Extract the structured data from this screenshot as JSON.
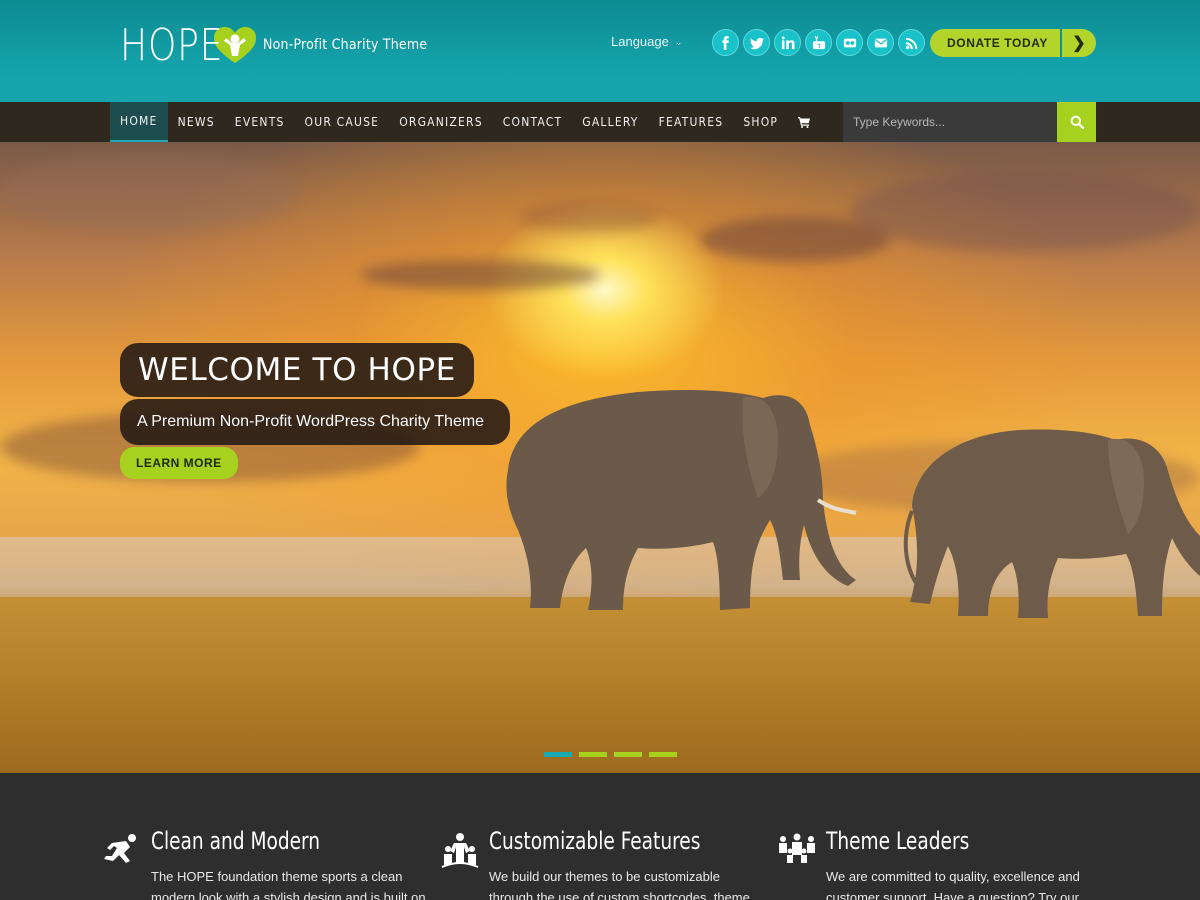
{
  "header": {
    "logo_text": "HOPE",
    "tagline": "Non-Profit Charity Theme",
    "language": "Language",
    "socials": [
      "facebook-icon",
      "twitter-icon",
      "linkedin-icon",
      "youtube-icon",
      "flickr-icon",
      "email-icon",
      "rss-icon"
    ],
    "donate_label": "DONATE TODAY"
  },
  "nav": {
    "items": [
      "HOME",
      "NEWS",
      "EVENTS",
      "OUR CAUSE",
      "ORGANIZERS",
      "CONTACT",
      "GALLERY",
      "FEATURES",
      "SHOP"
    ],
    "search_placeholder": "Type Keywords..."
  },
  "hero": {
    "title": "WELCOME TO HOPE",
    "subtitle": "A Premium Non-Profit WordPress Charity Theme",
    "cta": "LEARN MORE",
    "slides": 4,
    "active_slide": 1
  },
  "features": [
    {
      "title": "Clean and Modern",
      "text": "The HOPE foundation theme sports a clean modern look with a stylish design and is built on"
    },
    {
      "title": "Customizable Features",
      "text": "We build our themes to be customizable through the use of custom shortcodes, theme options"
    },
    {
      "title": "Theme Leaders",
      "text": "We are committed to quality, excellence and customer support. Have a question? Try our live"
    }
  ],
  "colors": {
    "header_teal": "#14a0a8",
    "accent_green": "#a6d11e",
    "nav_dark": "#30281e",
    "footer_dark": "#2e2e2e"
  }
}
